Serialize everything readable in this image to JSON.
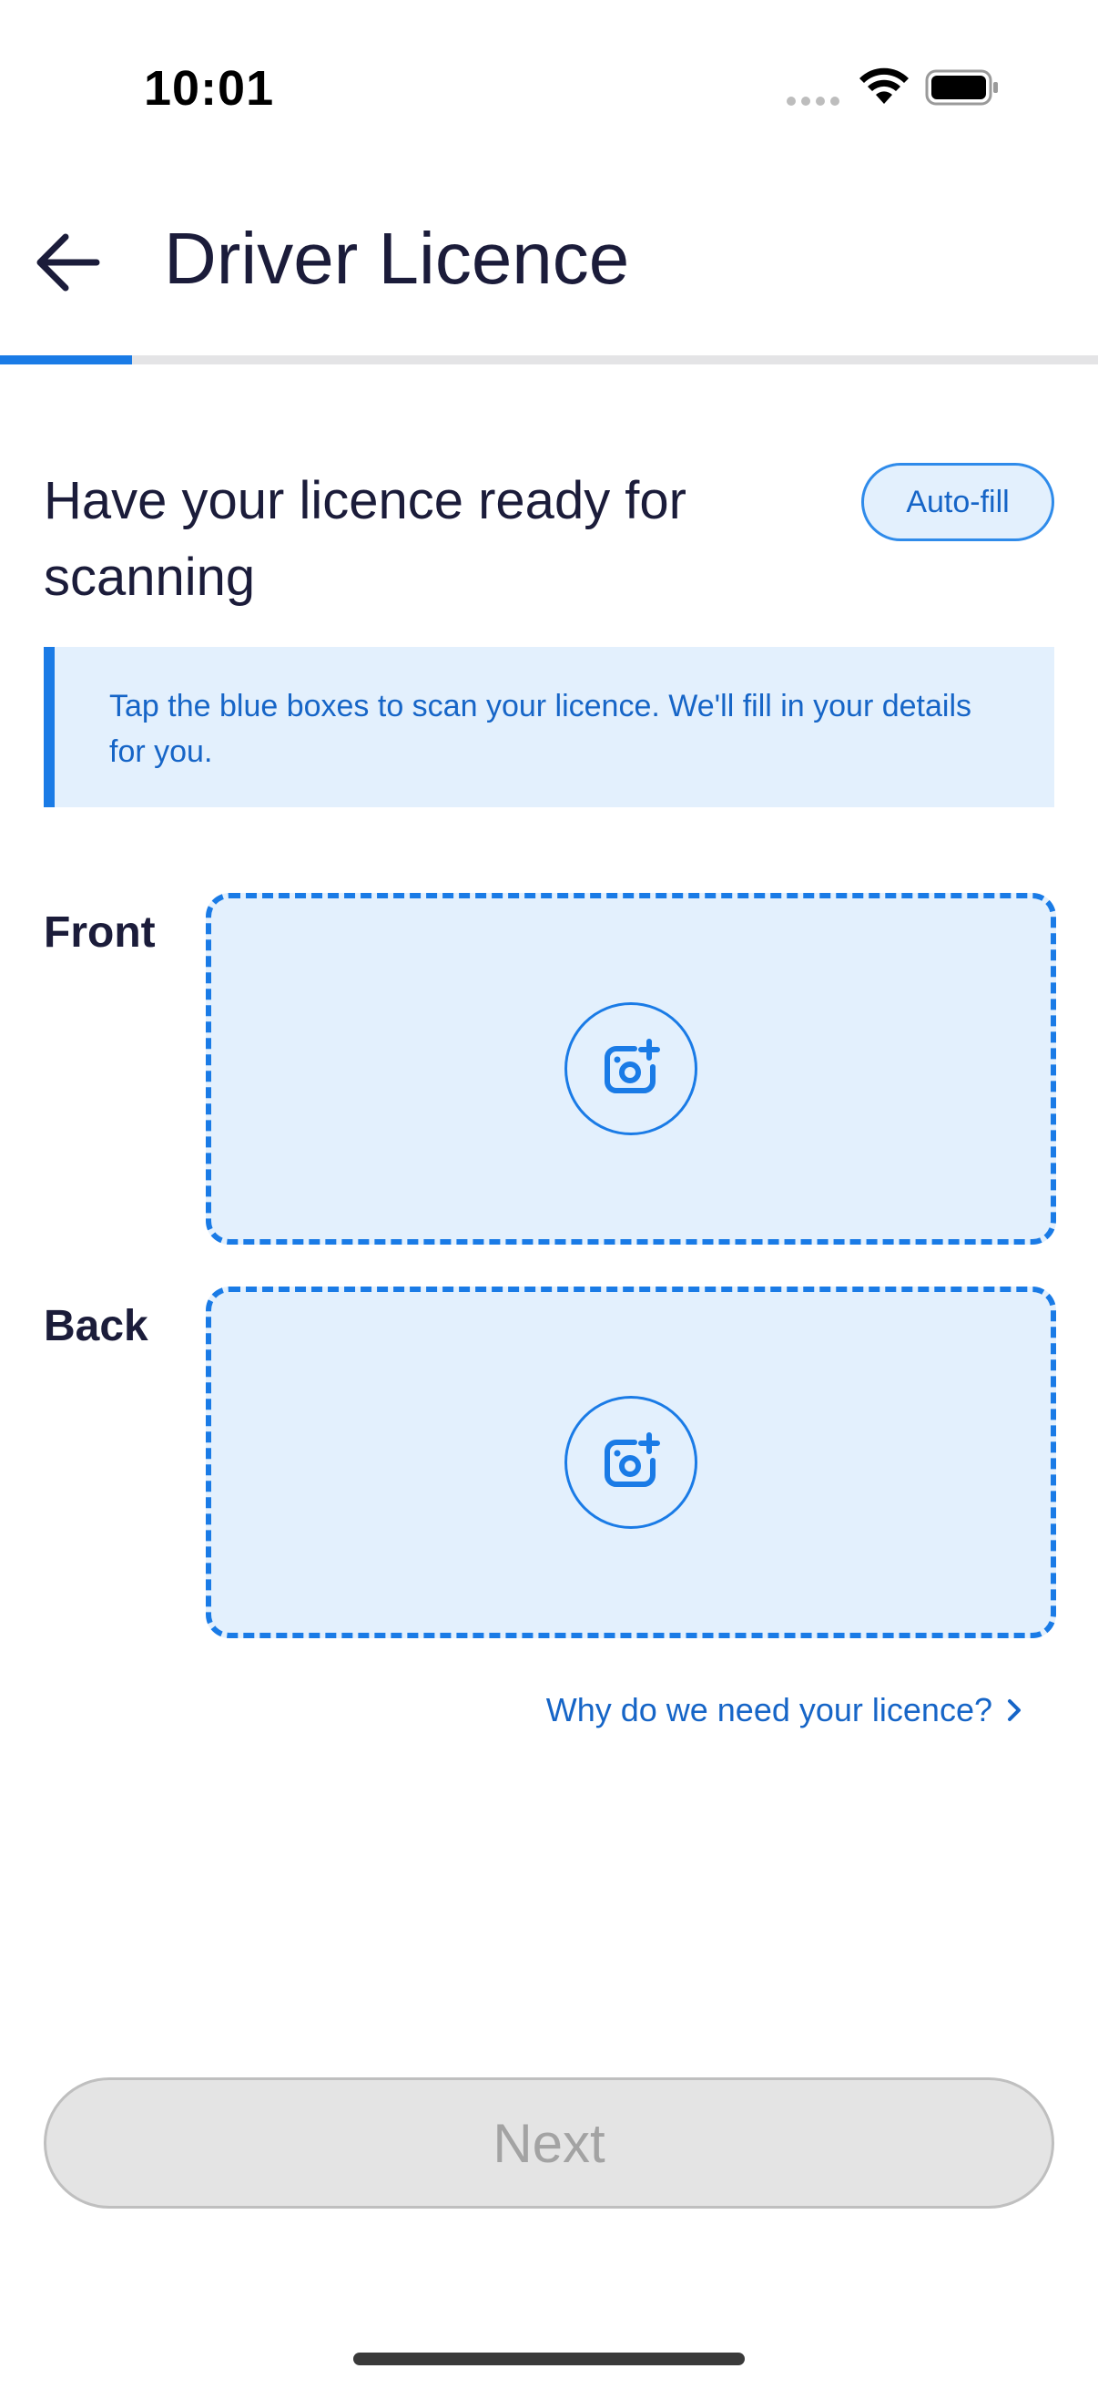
{
  "status_bar": {
    "time": "10:01"
  },
  "header": {
    "title": "Driver Licence",
    "back_icon": "arrow-left-icon"
  },
  "progress": {
    "fraction": 0.12,
    "color": "#1a7be6"
  },
  "intro": {
    "heading": "Have your licence ready for scanning",
    "autofill_label": "Auto-fill"
  },
  "info_banner": {
    "text": "Tap the blue boxes to scan your licence. We'll fill in your details for you."
  },
  "scan": {
    "front_label": "Front",
    "back_label": "Back",
    "icon": "camera-plus-icon"
  },
  "help_link": {
    "text": "Why do we need your licence?",
    "icon": "chevron-right-icon"
  },
  "footer": {
    "next_label": "Next"
  },
  "colors": {
    "accent": "#1a7be6",
    "link": "#1665c7",
    "surface_tint": "#e3f0fd",
    "disabled": "#e4e4e4"
  }
}
